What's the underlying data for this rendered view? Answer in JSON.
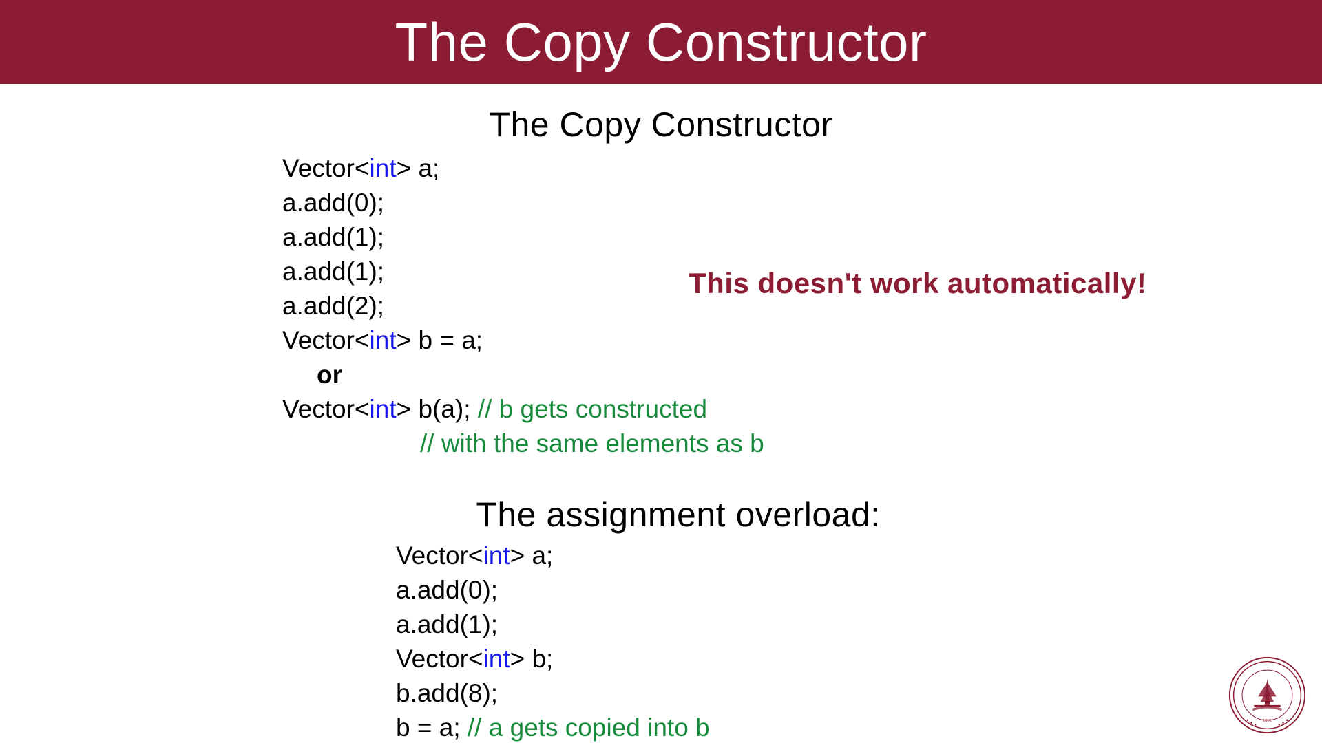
{
  "header": {
    "title": "The Copy Constructor"
  },
  "section1": {
    "title": "The Copy Constructor",
    "line1_pre": "Vector<",
    "line1_kw": "int",
    "line1_post": "> a;",
    "l2": "a.add(0);",
    "l3": "a.add(1);",
    "l4": "a.add(1);",
    "l5": "a.add(2);",
    "l6_pre": "Vector<",
    "l6_kw": "int",
    "l6_post": "> b = a;",
    "or_word": "or",
    "l7_pre": "Vector<",
    "l7_kw": "int",
    "l7_post": "> b(a); ",
    "l7_comment": "// b gets constructed",
    "l8_comment": "// with the same elements as b"
  },
  "callout": {
    "text": "This doesn't work automatically!"
  },
  "section2": {
    "title": "The assignment overload:",
    "l1_pre": "Vector<",
    "l1_kw": "int",
    "l1_post": "> a;",
    "l2": "a.add(0);",
    "l3": "a.add(1);",
    "l4_pre": "Vector<",
    "l4_kw": "int",
    "l4_post": "> b;",
    "l5": "b.add(8);",
    "l6_pre": "b = a; ",
    "l6_comment": "// a gets copied into b"
  },
  "colors": {
    "header_bg": "#8c1c34",
    "keyword_blue": "#1818ee",
    "comment_green": "#178a3b"
  }
}
